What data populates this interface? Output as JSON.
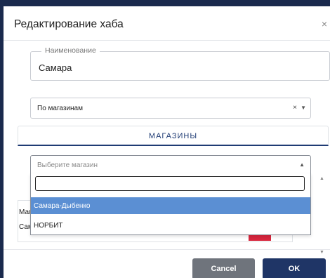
{
  "dialog": {
    "title": "Редактирование хаба",
    "close_glyph": "×"
  },
  "name_field": {
    "legend": "Наименование",
    "value": "Самара"
  },
  "mode_select": {
    "value": "По магазинам",
    "clear_glyph": "×",
    "arrow_glyph": "▼"
  },
  "tabs": [
    {
      "label": "МАГАЗИНЫ"
    }
  ],
  "store_select": {
    "placeholder": "Выберите магазин",
    "arrow_glyph": "▲",
    "search_value": ""
  },
  "dropdown": {
    "options": [
      {
        "label": "Самара-Дыбенко",
        "highlighted": true
      },
      {
        "label": "НОРБИТ"
      }
    ]
  },
  "table": {
    "header_fragment": "Маг",
    "row_fragment": "Сам"
  },
  "scrollbar": {
    "up_glyph": "▲",
    "down_glyph": "▼"
  },
  "footer": {
    "cancel_label": "Cancel",
    "ok_label": "OK"
  },
  "colors": {
    "accent": "#1f3566",
    "highlight": "#5b8fd3",
    "danger": "#d7263d",
    "backdrop": "#1a2a4d"
  }
}
